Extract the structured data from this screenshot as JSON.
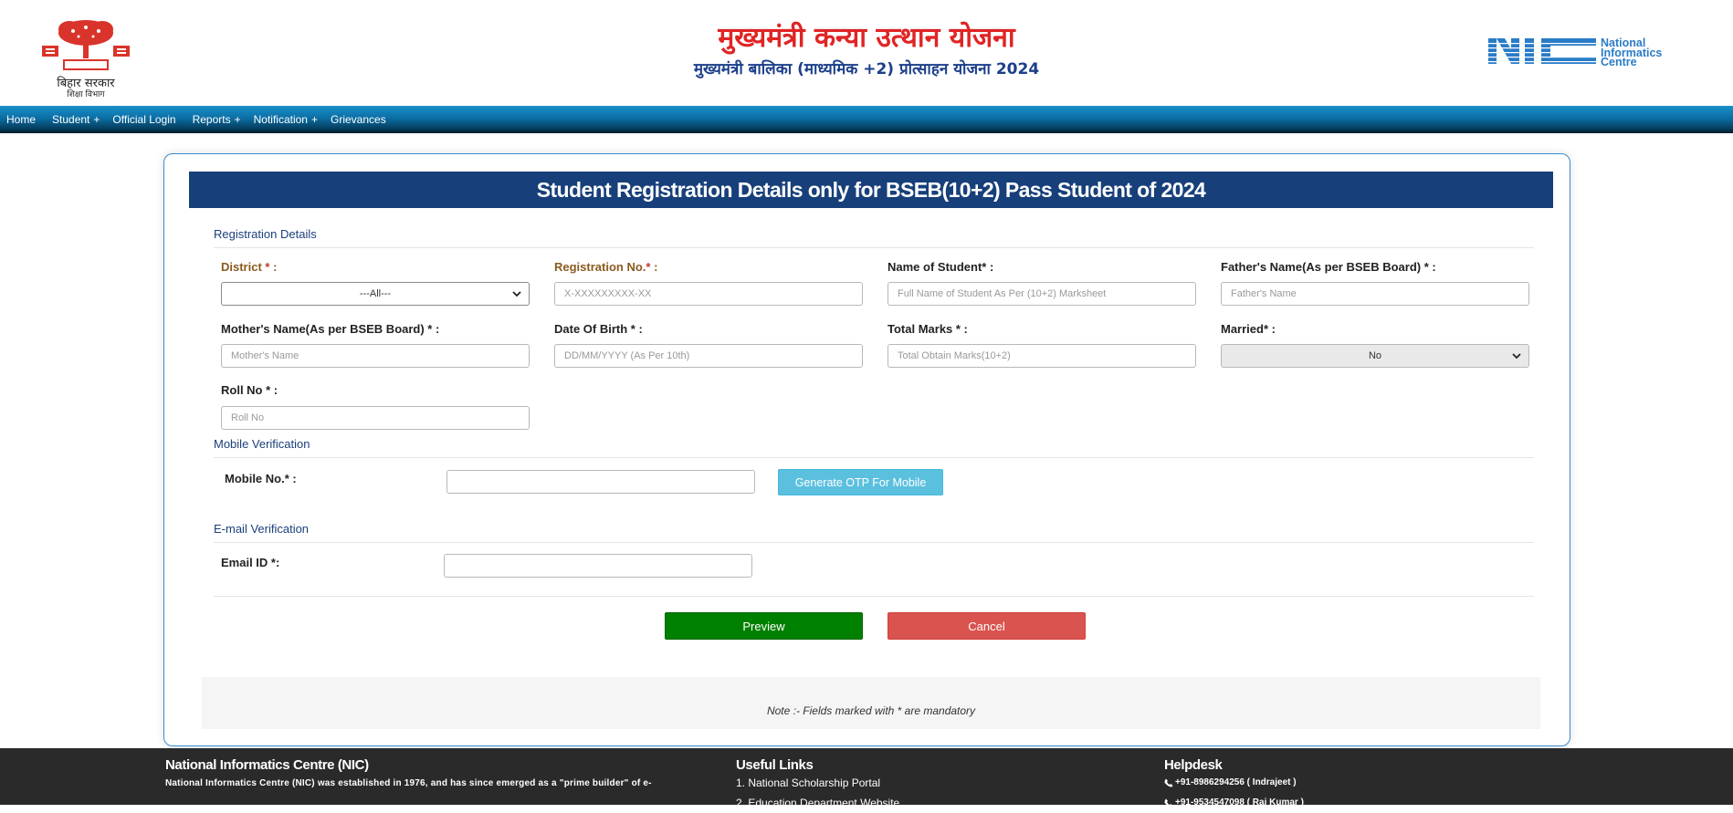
{
  "header": {
    "title_main": "मुख्यमंत्री कन्या उत्थान योजना",
    "title_sub": "मुख्यमंत्री बालिका (माध्यमिक +2) प्रोत्साहन योजना 2024",
    "bihar_logo_caption": "बिहार सरकार",
    "bihar_logo_subcaption": "शिक्षा विभाग",
    "nic_logo_text_1": "National",
    "nic_logo_text_2": "Informatics",
    "nic_logo_text_3": "Centre"
  },
  "nav": {
    "items": [
      {
        "label": "Home",
        "plus": ""
      },
      {
        "label": "Student",
        "plus": "+"
      },
      {
        "label": "Official Login",
        "plus": ""
      },
      {
        "label": "Reports",
        "plus": "+"
      },
      {
        "label": "Notification",
        "plus": "+"
      },
      {
        "label": "Grievances",
        "plus": ""
      }
    ]
  },
  "form": {
    "title": "Student Registration Details only for BSEB(10+2) Pass Student of 2024",
    "registration_section": "Registration Details",
    "district_label": "District",
    "district_star": "*",
    "district_colon": " :",
    "district_value": "---All---",
    "regno_label": "Registration No.",
    "regno_star": "*",
    "regno_colon": " :",
    "regno_placeholder": "X-XXXXXXXXX-XX",
    "student_name_label": "Name of Student* :",
    "student_name_placeholder": "Full Name of Student As Per (10+2) Marksheet",
    "father_label": "Father's Name(As per BSEB Board) * :",
    "father_placeholder": "Father's Name",
    "mother_label": "Mother's Name(As per BSEB Board) * :",
    "mother_placeholder": "Mother's Name",
    "dob_label": "Date Of Birth * :",
    "dob_placeholder": "DD/MM/YYYY (As Per 10th)",
    "marks_label": "Total Marks * :",
    "marks_placeholder": "Total Obtain Marks(10+2)",
    "married_label": "Married* :",
    "married_value": "No",
    "roll_label": "Roll No * :",
    "roll_placeholder": "Roll No",
    "mobile_section": "Mobile Verification",
    "mobile_label": "Mobile No.* :",
    "mobile_value": "",
    "otp_button": "Generate OTP For Mobile",
    "email_section": "E-mail Verification",
    "email_label": "Email ID *:",
    "email_value": "",
    "preview_button": "Preview",
    "cancel_button": "Cancel",
    "note": "Note :- Fields marked with * are mandatory"
  },
  "footer": {
    "nic_head": "National Informatics Centre (NIC)",
    "nic_text": "National Informatics Centre (NIC) was established in 1976, and has since emerged as a \"prime builder\" of e-",
    "links_head": "Useful Links",
    "links": [
      "1. National Scholarship Portal",
      "2. Education Department Website"
    ],
    "help_head": "Helpdesk",
    "phones": [
      "+91-8986294256 ( Indrajeet )",
      "+91-9534547098 ( Raj Kumar )"
    ]
  },
  "colors": {
    "title_red": "#e02424",
    "title_blue": "#1b3f8a",
    "banner": "#173f7a",
    "preview_green": "#008000",
    "cancel_red": "#d9534f",
    "otp_blue": "#5bc0de"
  }
}
